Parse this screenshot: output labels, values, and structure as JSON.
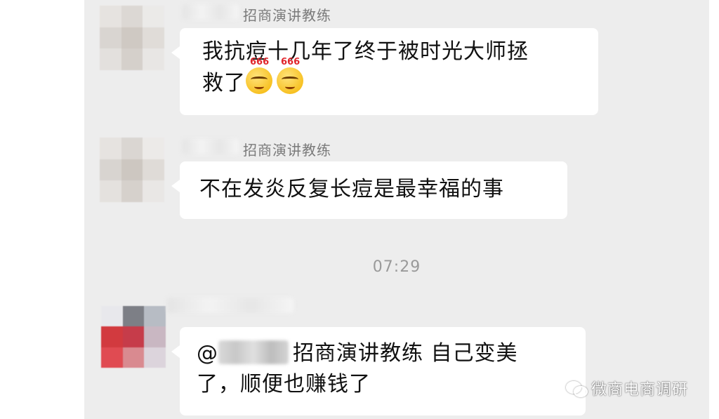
{
  "messages": [
    {
      "sender": "招商演讲教练",
      "text_line1": "我抗痘十几年了终于被时光大师拯",
      "text_line2": "救了",
      "emoji_label": "666"
    },
    {
      "sender": "招商演讲教练",
      "text": "不在发炎反复长痘是最幸福的事"
    },
    {
      "mention_prefix": "@",
      "text_line1": "招商演讲教练 自己变美",
      "text_line2": "了，顺便也赚钱了"
    }
  ],
  "timestamp": "07:29",
  "watermark": {
    "text": "微商电商调研",
    "icon": "wechat-logo-icon"
  },
  "colors": {
    "chat_background": "#ededed",
    "bubble": "#ffffff",
    "sender_name": "#7a7a7a",
    "timestamp": "#9a9a9a"
  }
}
